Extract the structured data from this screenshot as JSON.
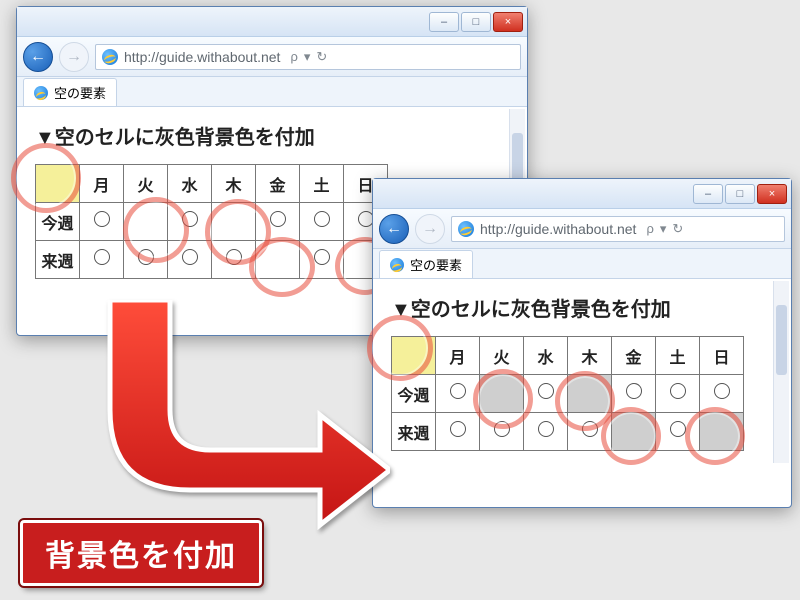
{
  "browser": {
    "url": "http://guide.withabout.net",
    "search_hint": "ρ",
    "refresh_glyph": "↻",
    "tab_title": "空の要素"
  },
  "page": {
    "heading": "▼空のセルに灰色背景色を付加",
    "days": [
      "月",
      "火",
      "水",
      "木",
      "金",
      "土",
      "日"
    ],
    "rows": [
      {
        "label": "今週",
        "cells": [
          "○",
          "",
          "○",
          "",
          "○",
          "○",
          "○"
        ]
      },
      {
        "label": "来週",
        "cells": [
          "○",
          "○",
          "○",
          "○",
          "",
          "○",
          ""
        ]
      }
    ]
  },
  "arrow_caption": "背景色を付加",
  "window_controls": {
    "min": "–",
    "max": "□",
    "close": "×"
  }
}
